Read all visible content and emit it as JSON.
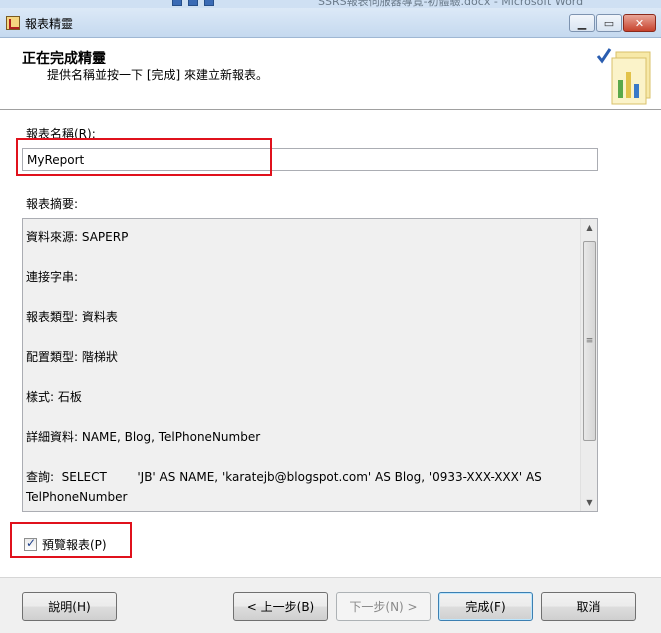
{
  "window": {
    "title": "報表精靈",
    "background_title": "SSRS報表伺服器導覽-初體驗.docx - Microsoft Word"
  },
  "header": {
    "title": "正在完成精靈",
    "subtitle": "提供名稱並按一下 [完成] 來建立新報表。"
  },
  "report_name": {
    "label": "報表名稱(R):",
    "value": "MyReport"
  },
  "summary": {
    "label": "報表摘要:",
    "lines": [
      "資料來源: SAPERP",
      "連接字串:",
      "報表類型: 資料表",
      "配置類型: 階梯狀",
      "樣式: 石板",
      "詳細資料: NAME, Blog, TelPhoneNumber",
      "查詢:  SELECT        'JB' AS NAME, 'karatejb@blogspot.com' AS Blog, '0933-XXX-XXX' AS TelPhoneNumber\nUNION"
    ]
  },
  "preview": {
    "label": "預覽報表(P)",
    "checked": true
  },
  "buttons": {
    "help": "說明(H)",
    "back": "< 上一步(B)",
    "next": "下一步(N) >",
    "finish": "完成(F)",
    "cancel": "取消"
  },
  "colors": {
    "highlight": "#e0111c",
    "titlebar": "#c5d9ef",
    "footer": "#f0f0f0"
  }
}
